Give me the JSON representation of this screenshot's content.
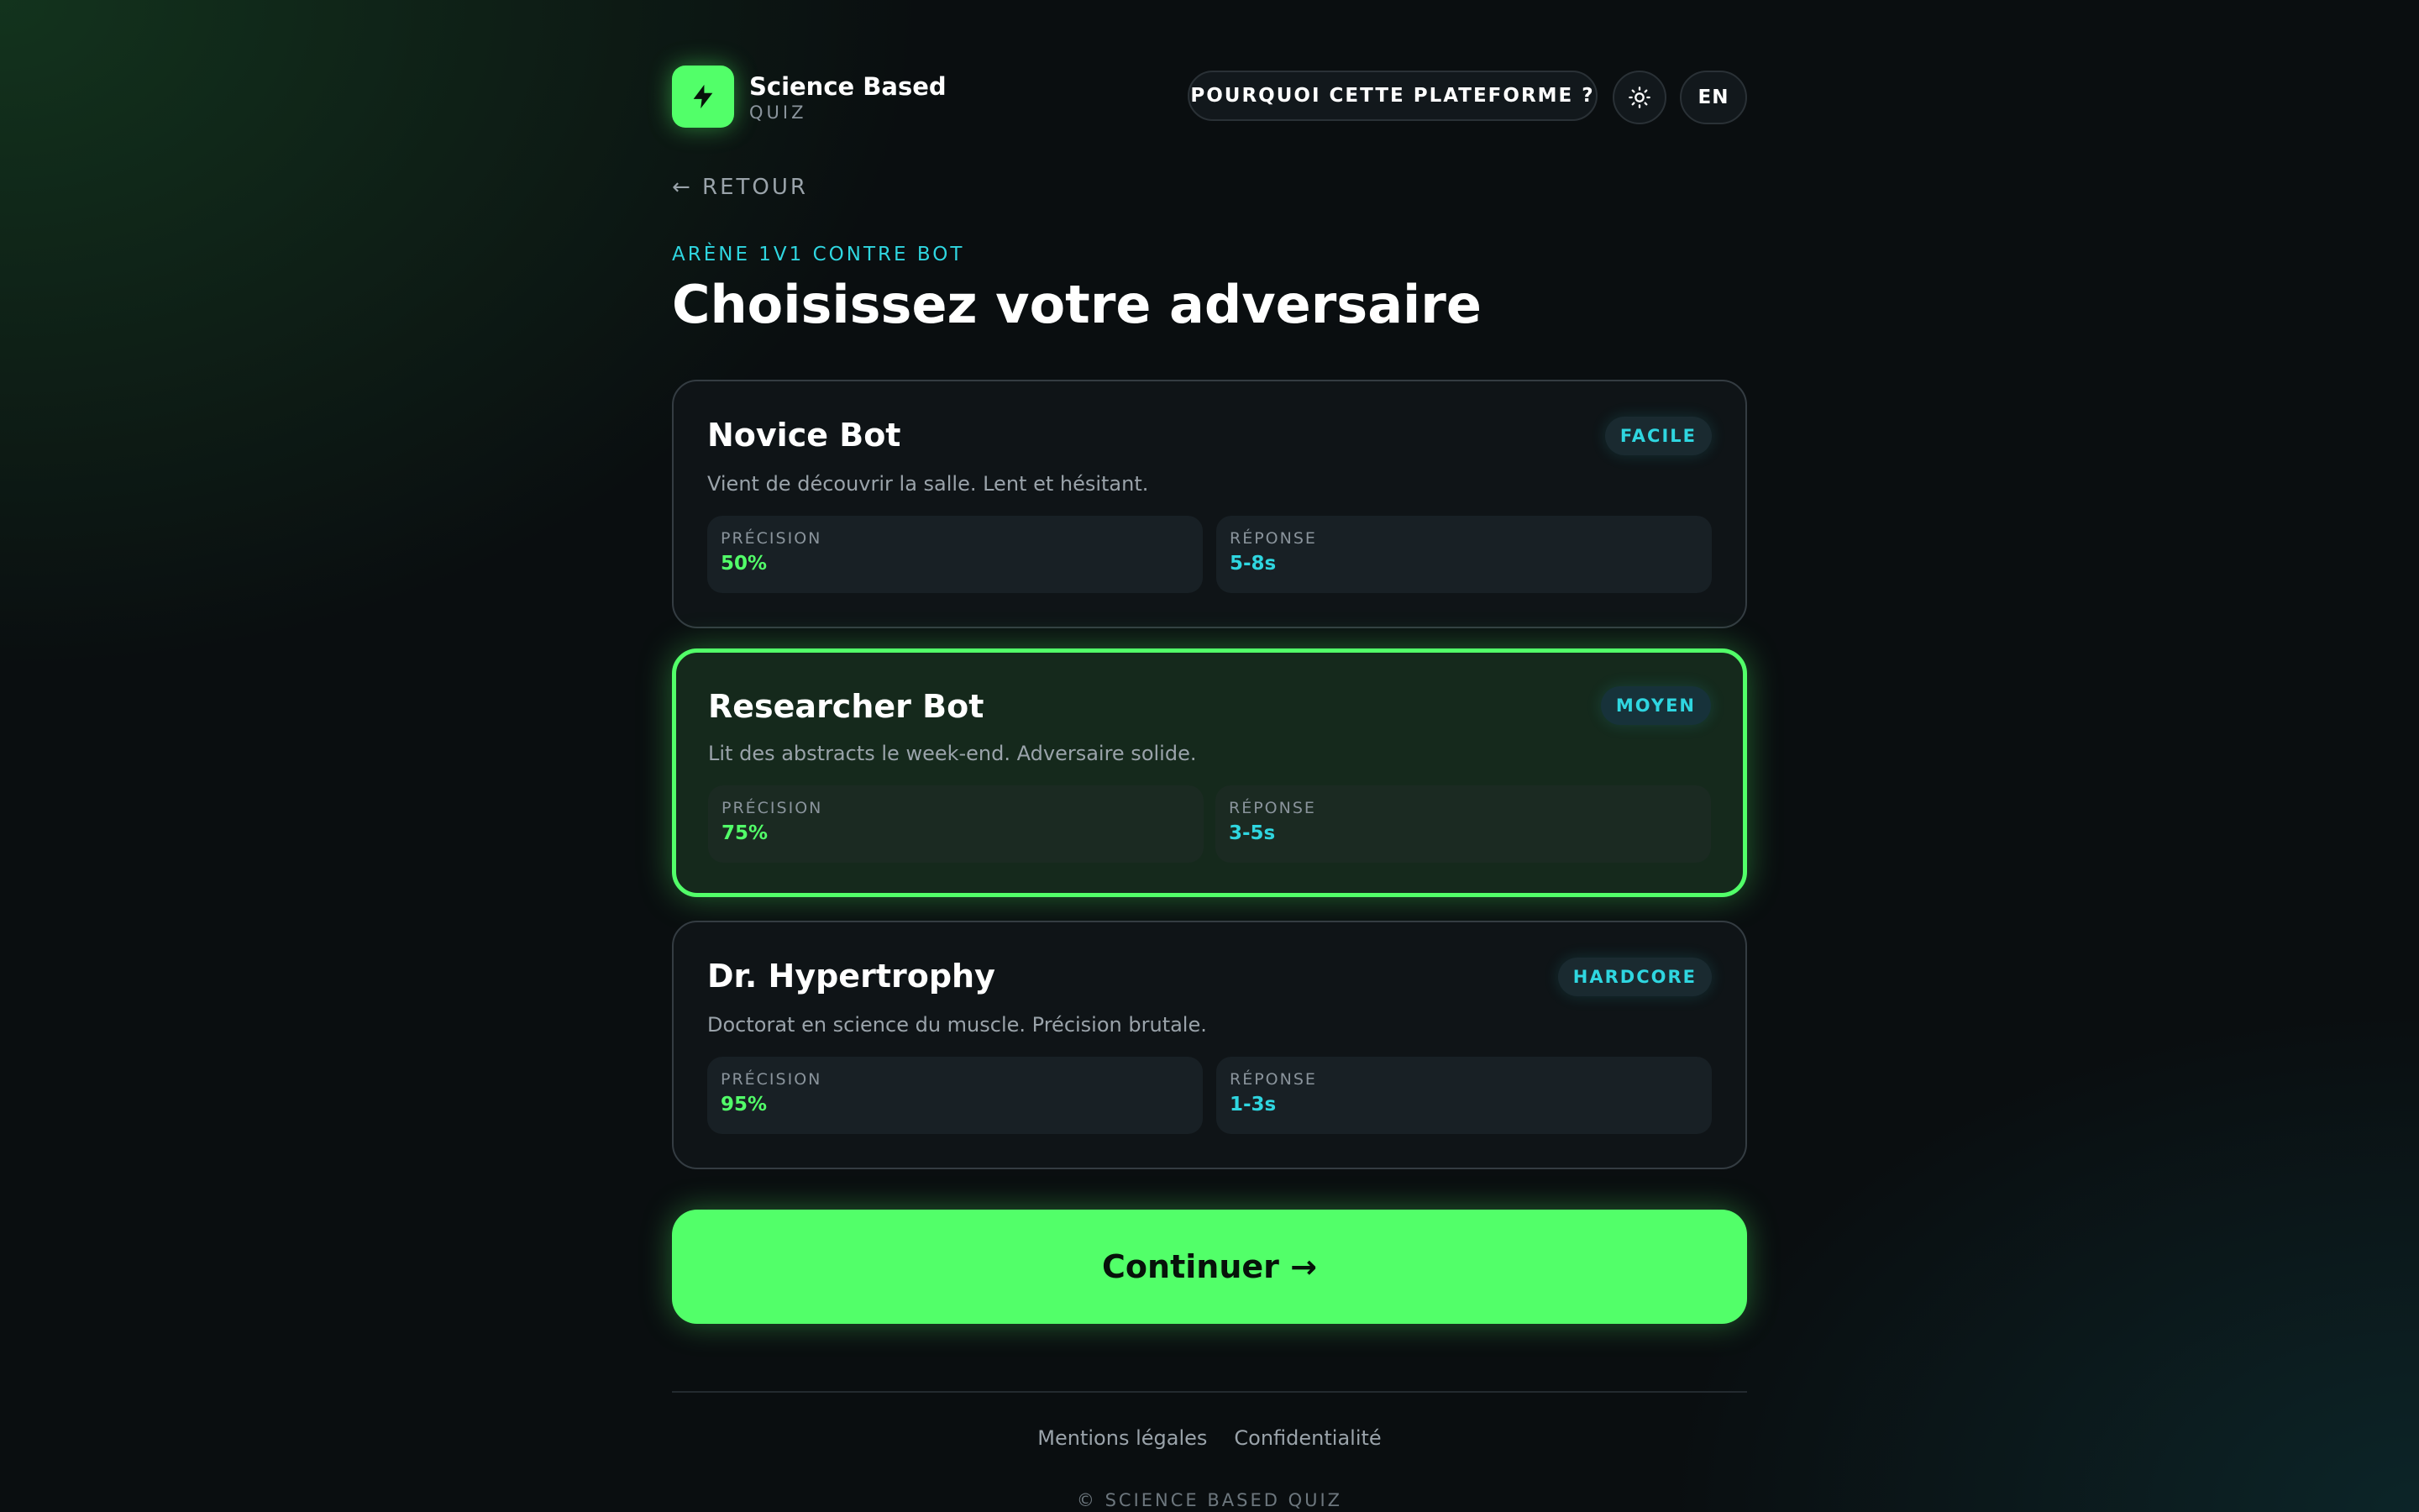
{
  "header": {
    "brand_name": "Science Based",
    "brand_sub": "QUIZ",
    "logo_icon": "lightning-bolt-icon",
    "why_button": "POURQUOI CETTE PLATEFORME ?",
    "theme_icon": "sun-icon",
    "lang_button": "EN"
  },
  "nav": {
    "back": "← RETOUR"
  },
  "main": {
    "eyebrow": "ARÈNE 1V1 CONTRE BOT",
    "title": "Choisissez votre adversaire",
    "bots": [
      {
        "name": "Novice Bot",
        "badge": "FACILE",
        "description": "Vient de découvrir la salle. Lent et hésitant.",
        "precision_label": "PRÉCISION",
        "precision_value": "50%",
        "response_label": "RÉPONSE",
        "response_value": "5-8s",
        "selected": false
      },
      {
        "name": "Researcher Bot",
        "badge": "MOYEN",
        "description": "Lit des abstracts le week-end. Adversaire solide.",
        "precision_label": "PRÉCISION",
        "precision_value": "75%",
        "response_label": "RÉPONSE",
        "response_value": "3-5s",
        "selected": true
      },
      {
        "name": "Dr. Hypertrophy",
        "badge": "HARDCORE",
        "description": "Doctorat en science du muscle. Précision brutale.",
        "precision_label": "PRÉCISION",
        "precision_value": "95%",
        "response_label": "RÉPONSE",
        "response_value": "1-3s",
        "selected": false
      }
    ],
    "continue_button": "Continuer →"
  },
  "footer": {
    "links": [
      "Mentions légales",
      "Confidentialité"
    ],
    "copyright": "© SCIENCE BASED QUIZ"
  },
  "colors": {
    "background": "#0a0e10",
    "accent_green": "#52ff69",
    "accent_cyan": "#2fd6e0",
    "card_border": "#343c42",
    "muted_text": "#9aa3aa"
  }
}
